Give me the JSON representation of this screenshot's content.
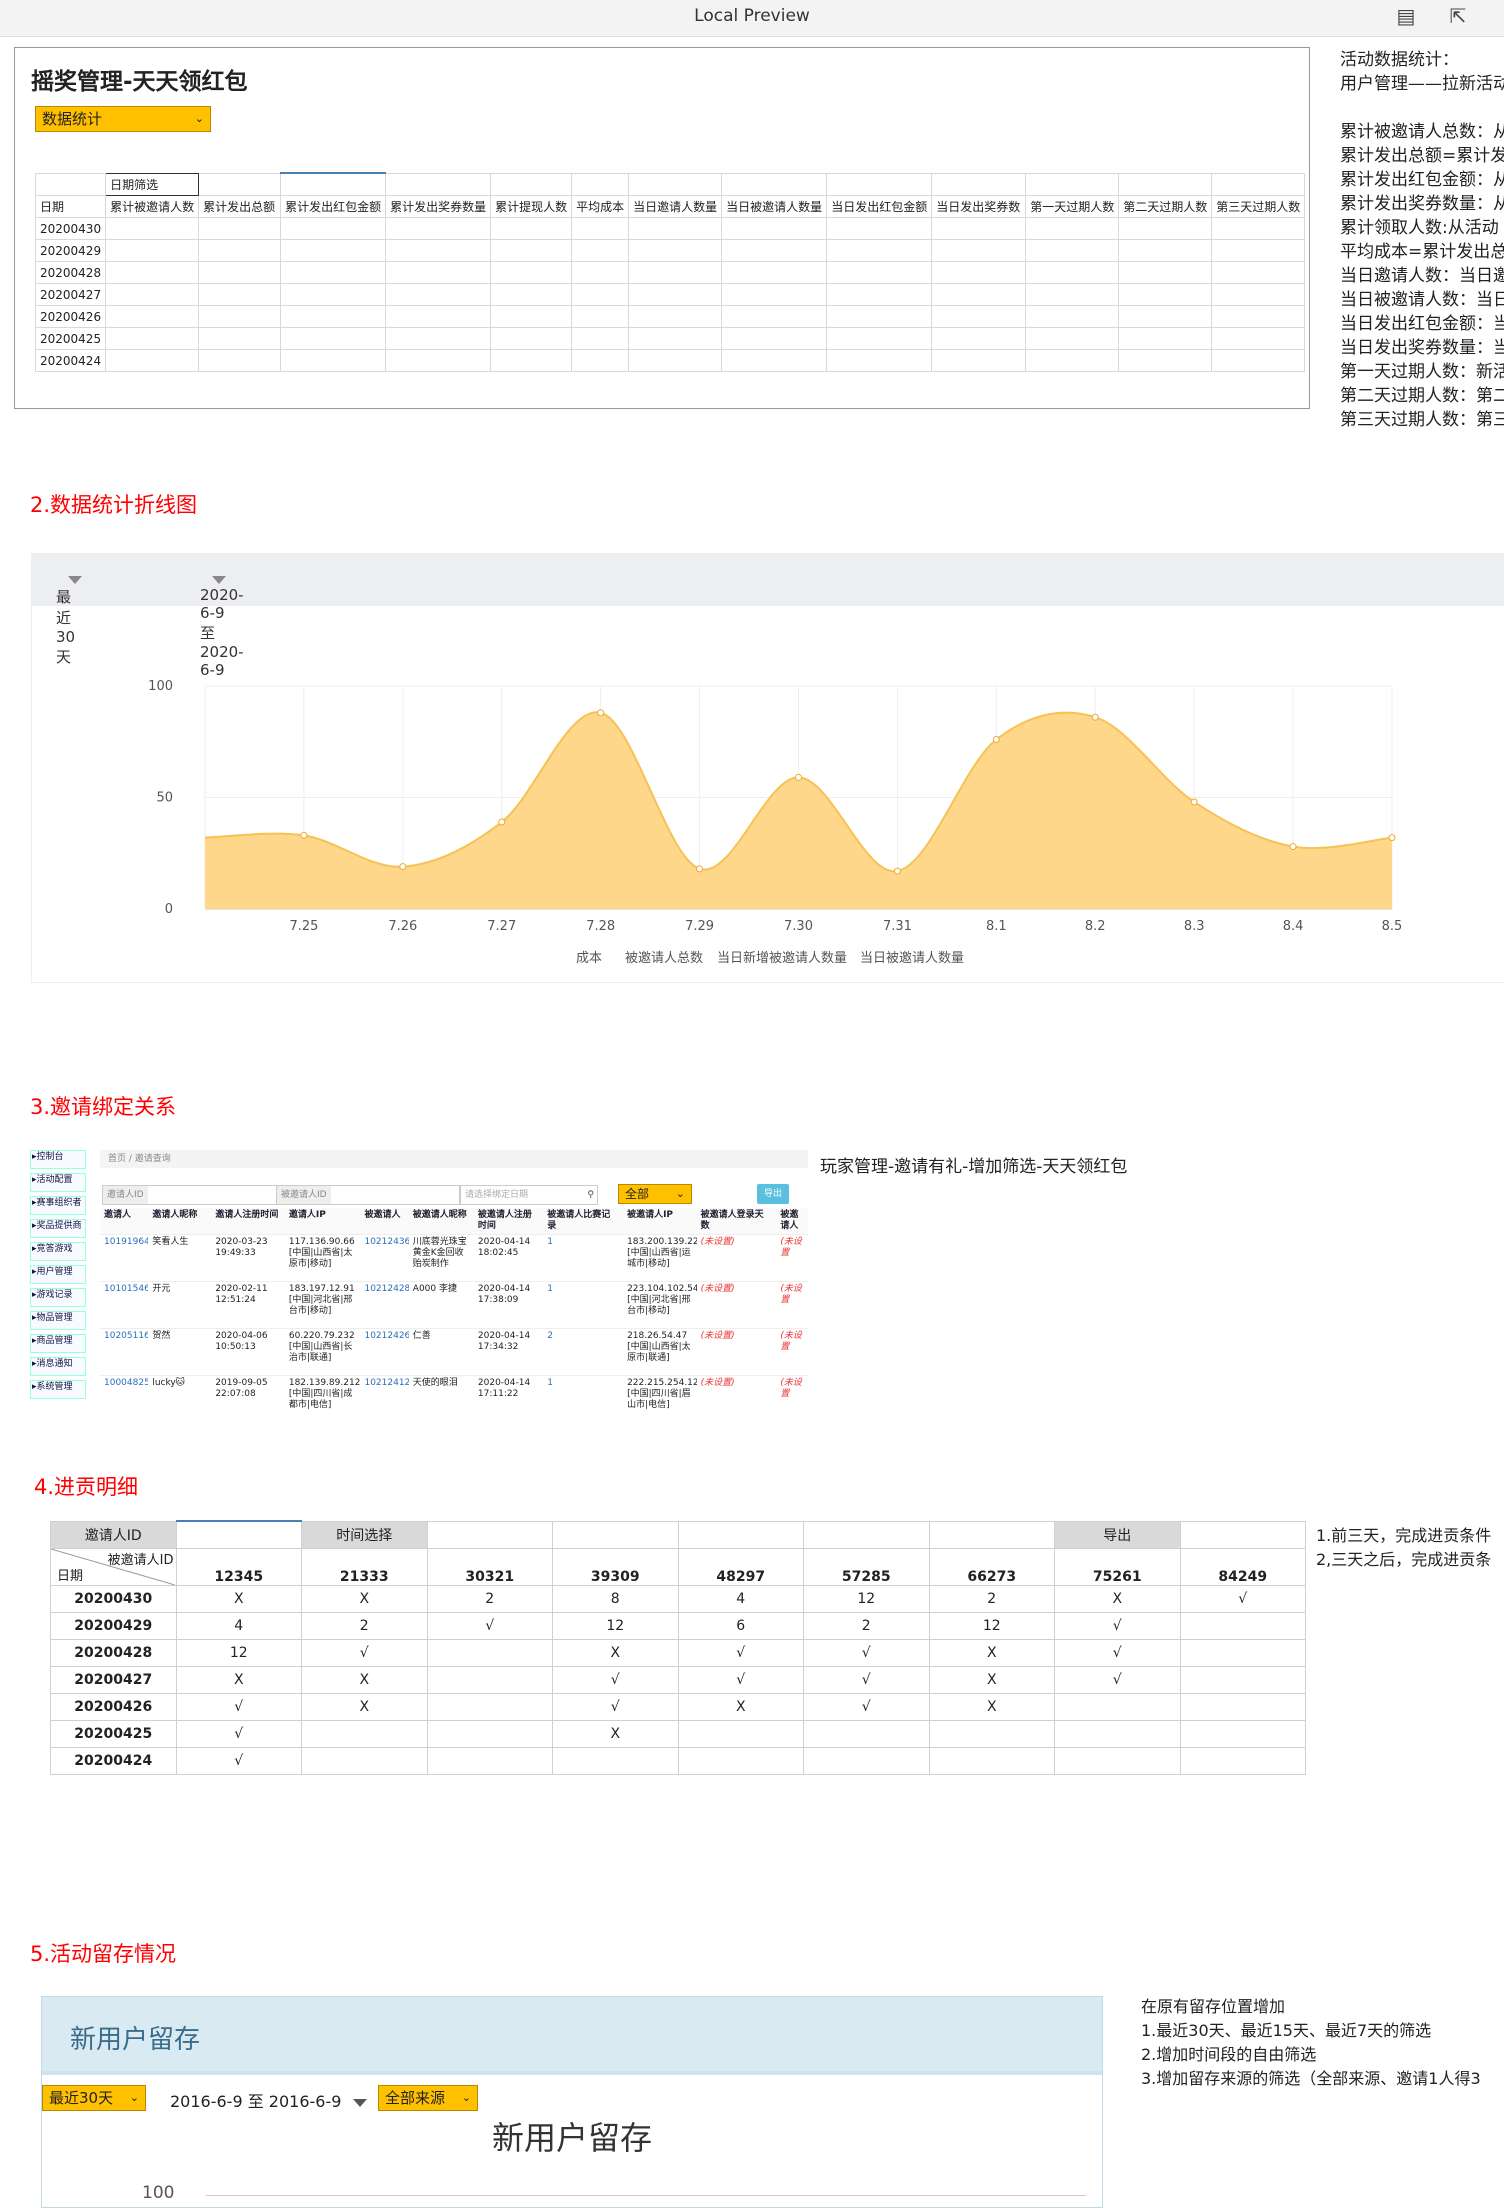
{
  "window": {
    "title": "Local Preview",
    "icons": [
      "reader-icon",
      "export-icon"
    ]
  },
  "section1": {
    "title": "摇奖管理-天天领红包",
    "select": "数据统计",
    "filter_label": "日期筛选",
    "columns": [
      "日期",
      "累计被邀请人数",
      "累计发出总额",
      "累计发出红包金额",
      "累计发出奖券数量",
      "累计提现人数",
      "平均成本",
      "当日邀请人数量",
      "当日被邀请人数量",
      "当日发出红包金额",
      "当日发出奖券数",
      "第一天过期人数",
      "第二天过期人数",
      "第三天过期人数"
    ],
    "dates": [
      "20200430",
      "20200429",
      "20200428",
      "20200427",
      "20200426",
      "20200425",
      "20200424"
    ],
    "notes": "活动数据统计：\n用户管理——拉新活动\n\n累计被邀请人总数：从\n累计发出总额=累计发\n累计发出红包金额：从\n累计发出奖券数量：从\n累计领取人数:从活动\n平均成本=累计发出总\n当日邀请人数：当日邀\n当日被邀请人数：当日\n当日发出红包金额：当\n当日发出奖券数量：当\n第一天过期人数：新活\n第二天过期人数：第二\n第三天过期人数：第三"
  },
  "section2": {
    "heading": "2.数据统计折线图",
    "range": "最近30天",
    "dates": "2020-6-9 至 2020-6-9"
  },
  "chart_data": {
    "type": "area",
    "x": [
      "",
      "7.25",
      "7.26",
      "7.27",
      "7.28",
      "7.29",
      "7.30",
      "7.31",
      "8.1",
      "8.2",
      "8.3",
      "8.4",
      "8.5"
    ],
    "yticks": [
      "0",
      "50",
      "100"
    ],
    "ylim": [
      0,
      100
    ],
    "series": [
      {
        "values": [
          32,
          33,
          19,
          39,
          88,
          18,
          59,
          17,
          76,
          86,
          48,
          28,
          32
        ]
      }
    ],
    "legend": [
      "成本",
      "被邀请人总数",
      "当日新增被邀请人数量",
      "当日被邀请人数量"
    ],
    "grid": true
  },
  "section3": {
    "heading": "3.邀请绑定关系",
    "note": "玩家管理-邀请有礼-增加筛选-天天领红包",
    "breadcrumb": [
      "首页",
      "邀请查询"
    ],
    "sidebar": [
      "控制台",
      "活动配置",
      "赛事组织者",
      "奖品提供商",
      "竞答游戏",
      "用户管理",
      "游戏记录",
      "物品管理",
      "商品管理",
      "消息通知",
      "系统管理"
    ],
    "filters": {
      "inviter": "邀请人ID",
      "invitee": "被邀请人ID",
      "date": "请选择绑定日期",
      "all": "全部",
      "export": "导出"
    },
    "headers": [
      "邀请人",
      "邀请人昵称",
      "邀请人注册时间",
      "邀请人IP",
      "被邀请人",
      "被邀请人昵称",
      "被邀请人注册时间",
      "被邀请人比赛记录",
      "被邀请人IP",
      "被邀请人登录天数",
      "被邀请人"
    ],
    "rows": [
      [
        "10191964",
        "笑看人生",
        "2020-03-23 19:49:33",
        "117.136.90.66 [中国|山西省|太原市|移动]",
        "10212436",
        "川底蓉光珠宝黄金K金回收贻炭制作",
        "2020-04-14 18:02:45",
        "1",
        "183.200.139.221 [中国|山西省|运城市|移动]",
        "(未设置)",
        "(未设置"
      ],
      [
        "10101546",
        "开元",
        "2020-02-11 12:51:24",
        "183.197.12.91 [中国|河北省|邢台市|移动]",
        "10212428",
        "A000 李捷",
        "2020-04-14 17:38:09",
        "1",
        "223.104.102.54 [中国|河北省|邢台市|移动]",
        "(未设置)",
        "(未设置"
      ],
      [
        "10205116",
        "贺然",
        "2020-04-06 10:50:13",
        "60.220.79.232 [中国|山西省|长治市|联通]",
        "10212426",
        "仁善",
        "2020-04-14 17:34:32",
        "2",
        "218.26.54.47 [中国|山西省|太原市|联通]",
        "(未设置)",
        "(未设置"
      ],
      [
        "10004825",
        "lucky🐱",
        "2019-09-05 22:07:08",
        "182.139.89.212 [中国|四川省|成都市|电信]",
        "10212412",
        "天使的眼泪",
        "2020-04-14 17:11:22",
        "1",
        "222.215.254.121 [中国|四川省|眉山市|电信]",
        "(未设置)",
        "(未设置"
      ]
    ]
  },
  "section4": {
    "heading": "4.进贡明细",
    "inviter_label": "邀请人ID",
    "time_label": "时间选择",
    "export_label": "导出",
    "corner_top": "被邀请人ID",
    "corner_bottom": "日期",
    "ids": [
      "12345",
      "21333",
      "30321",
      "39309",
      "48297",
      "57285",
      "66273",
      "75261",
      "84249"
    ],
    "rows": [
      {
        "date": "20200430",
        "cells": [
          "X",
          "X",
          "2",
          "8",
          "4",
          "12",
          "2",
          "X",
          "√"
        ]
      },
      {
        "date": "20200429",
        "cells": [
          "4",
          "2",
          "√",
          "12",
          "6",
          "2",
          "12",
          "√",
          ""
        ]
      },
      {
        "date": "20200428",
        "cells": [
          "12",
          "√",
          "",
          "X",
          "√",
          "√",
          "X",
          "√",
          ""
        ]
      },
      {
        "date": "20200427",
        "cells": [
          "X",
          "X",
          "",
          "√",
          "√",
          "√",
          "X",
          "√",
          ""
        ]
      },
      {
        "date": "20200426",
        "cells": [
          "√",
          "X",
          "",
          "√",
          "X",
          "√",
          "X",
          "",
          ""
        ]
      },
      {
        "date": "20200425",
        "cells": [
          "√",
          "",
          "",
          "X",
          "",
          "",
          "",
          "",
          ""
        ]
      },
      {
        "date": "20200424",
        "cells": [
          "√",
          "",
          "",
          "",
          "",
          "",
          "",
          "",
          ""
        ]
      }
    ],
    "notes": "1.前三天，完成进贡条件\n2,三天之后，完成进贡条"
  },
  "section5": {
    "heading": "5.活动留存情况",
    "panel_title": "新用户留存",
    "range": "最近30天",
    "dates": "2016-6-9 至 2016-6-9",
    "source": "全部来源",
    "chart_title": "新用户留存",
    "ytick": "100",
    "notes": "在原有留存位置增加\n1.最近30天、最近15天、最近7天的筛选\n2.增加时间段的自由筛选\n3.增加留存来源的筛选（全部来源、邀请1人得3"
  }
}
